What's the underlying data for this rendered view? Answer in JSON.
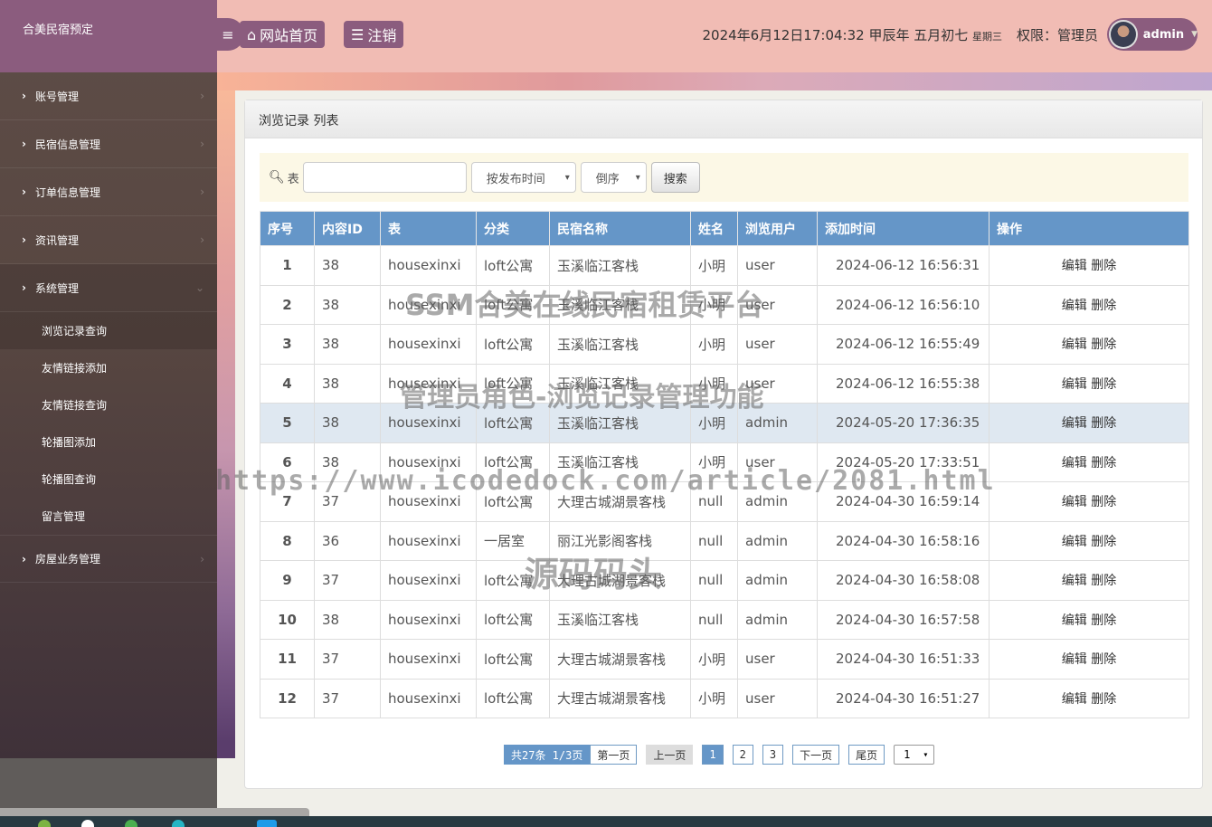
{
  "brand": "合美民宿预定",
  "header": {
    "home_label": "网站首页",
    "logout_label": "注销",
    "datetime": "2024年6月12日17:04:32 甲辰年 五月初七",
    "weekday": "星期三",
    "role": "权限：管理员",
    "username": "admin"
  },
  "sidebar": {
    "items": [
      {
        "label": "账号管理"
      },
      {
        "label": "民宿信息管理"
      },
      {
        "label": "订单信息管理"
      },
      {
        "label": "资讯管理"
      },
      {
        "label": "系统管理"
      }
    ],
    "subitems": [
      {
        "label": "浏览记录查询"
      },
      {
        "label": "友情链接添加"
      },
      {
        "label": "友情链接查询"
      },
      {
        "label": "轮播图添加"
      },
      {
        "label": "轮播图查询"
      },
      {
        "label": "留言管理"
      }
    ],
    "last_item": "房屋业务管理"
  },
  "panel": {
    "title": "浏览记录 列表",
    "search_label": "表",
    "search_value": "",
    "sort_field": "按发布时间",
    "sort_order": "倒序",
    "search_button": "搜索"
  },
  "table": {
    "headers": [
      "序号",
      "内容ID",
      "表",
      "分类",
      "民宿名称",
      "姓名",
      "浏览用户",
      "添加时间",
      "操作"
    ],
    "edit_label": "编辑",
    "delete_label": "删除",
    "rows": [
      {
        "no": "1",
        "cid": "38",
        "tbl": "housexinxi",
        "cat": "loft公寓",
        "name": "玉溪临江客栈",
        "person": "小明",
        "user": "user",
        "time": "2024-06-12 16:56:31"
      },
      {
        "no": "2",
        "cid": "38",
        "tbl": "housexinxi",
        "cat": "loft公寓",
        "name": "玉溪临江客栈",
        "person": "小明",
        "user": "user",
        "time": "2024-06-12 16:56:10"
      },
      {
        "no": "3",
        "cid": "38",
        "tbl": "housexinxi",
        "cat": "loft公寓",
        "name": "玉溪临江客栈",
        "person": "小明",
        "user": "user",
        "time": "2024-06-12 16:55:49"
      },
      {
        "no": "4",
        "cid": "38",
        "tbl": "housexinxi",
        "cat": "loft公寓",
        "name": "玉溪临江客栈",
        "person": "小明",
        "user": "user",
        "time": "2024-06-12 16:55:38"
      },
      {
        "no": "5",
        "cid": "38",
        "tbl": "housexinxi",
        "cat": "loft公寓",
        "name": "玉溪临江客栈",
        "person": "小明",
        "user": "admin",
        "time": "2024-05-20 17:36:35"
      },
      {
        "no": "6",
        "cid": "38",
        "tbl": "housexinxi",
        "cat": "loft公寓",
        "name": "玉溪临江客栈",
        "person": "小明",
        "user": "user",
        "time": "2024-05-20 17:33:51"
      },
      {
        "no": "7",
        "cid": "37",
        "tbl": "housexinxi",
        "cat": "loft公寓",
        "name": "大理古城湖景客栈",
        "person": "null",
        "user": "admin",
        "time": "2024-04-30 16:59:14"
      },
      {
        "no": "8",
        "cid": "36",
        "tbl": "housexinxi",
        "cat": "一居室",
        "name": "丽江光影阁客栈",
        "person": "null",
        "user": "admin",
        "time": "2024-04-30 16:58:16"
      },
      {
        "no": "9",
        "cid": "37",
        "tbl": "housexinxi",
        "cat": "loft公寓",
        "name": "大理古城湖景客栈",
        "person": "null",
        "user": "admin",
        "time": "2024-04-30 16:58:08"
      },
      {
        "no": "10",
        "cid": "38",
        "tbl": "housexinxi",
        "cat": "loft公寓",
        "name": "玉溪临江客栈",
        "person": "null",
        "user": "admin",
        "time": "2024-04-30 16:57:58"
      },
      {
        "no": "11",
        "cid": "37",
        "tbl": "housexinxi",
        "cat": "loft公寓",
        "name": "大理古城湖景客栈",
        "person": "小明",
        "user": "user",
        "time": "2024-04-30 16:51:33"
      },
      {
        "no": "12",
        "cid": "37",
        "tbl": "housexinxi",
        "cat": "loft公寓",
        "name": "大理古城湖景客栈",
        "person": "小明",
        "user": "user",
        "time": "2024-04-30 16:51:27"
      }
    ]
  },
  "pager": {
    "info": "共27条  1/3页",
    "first": "第一页",
    "prev": "上一页",
    "pages": [
      "1",
      "2",
      "3"
    ],
    "current": "1",
    "next": "下一页",
    "last": "尾页",
    "jump_value": "1"
  },
  "watermark": {
    "line1": "SSM合美在线民宿租赁平台",
    "line2": "管理员角色-浏览记录管理功能",
    "line3": "https://www.icodedock.com/article/2081.html",
    "line4": "源码码头"
  },
  "colors": {
    "accent": "#8b5c7e",
    "table_header": "#6596c8",
    "header_bg": "#f1bcb4"
  }
}
